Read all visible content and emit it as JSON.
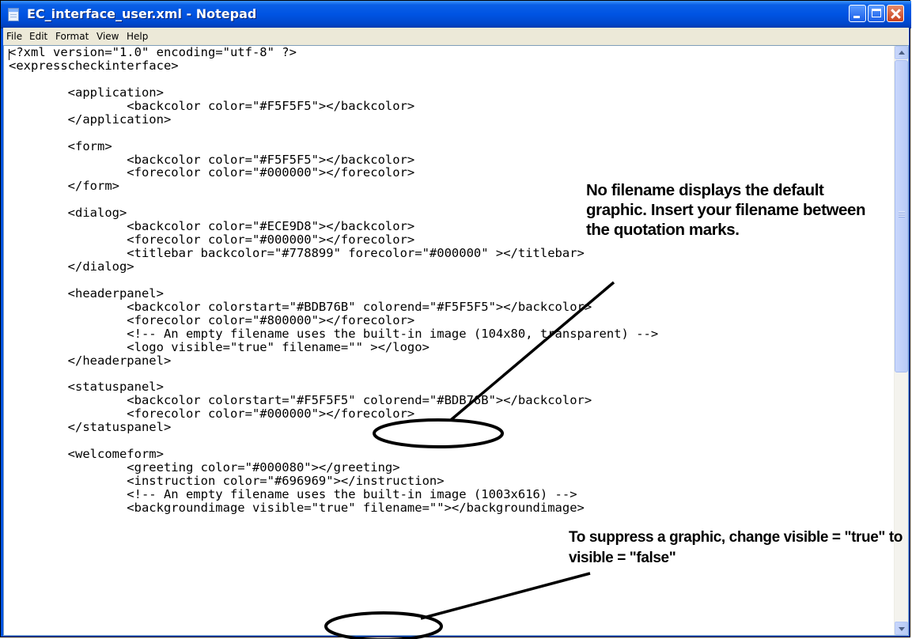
{
  "window": {
    "title": "EC_interface_user.xml - Notepad"
  },
  "menu": [
    "File",
    "Edit",
    "Format",
    "View",
    "Help"
  ],
  "editor": {
    "lines": [
      "<?xml version=\"1.0\" encoding=\"utf-8\" ?>",
      "<expresscheckinterface>",
      "",
      "        <application>",
      "                <backcolor color=\"#F5F5F5\"></backcolor>",
      "        </application>",
      "",
      "        <form>",
      "                <backcolor color=\"#F5F5F5\"></backcolor>",
      "                <forecolor color=\"#000000\"></forecolor>",
      "        </form>",
      "",
      "        <dialog>",
      "                <backcolor color=\"#ECE9D8\"></backcolor>",
      "                <forecolor color=\"#000000\"></forecolor>",
      "                <titlebar backcolor=\"#778899\" forecolor=\"#000000\" ></titlebar>",
      "        </dialog>",
      "",
      "        <headerpanel>",
      "                <backcolor colorstart=\"#BDB76B\" colorend=\"#F5F5F5\"></backcolor>",
      "                <forecolor color=\"#800000\"></forecolor>",
      "                <!-- An empty filename uses the built-in image (104x80, transparent) -->",
      "                <logo visible=\"true\" filename=\"\" ></logo>",
      "        </headerpanel>",
      "",
      "        <statuspanel>",
      "                <backcolor colorstart=\"#F5F5F5\" colorend=\"#BDB76B\"></backcolor>",
      "                <forecolor color=\"#000000\"></forecolor>",
      "        </statuspanel>",
      "",
      "        <welcomeform>",
      "                <greeting color=\"#000080\"></greeting>",
      "                <instruction color=\"#696969\"></instruction>",
      "                <!-- An empty filename uses the built-in image (1003x616) -->",
      "                <backgroundimage visible=\"true\" filename=\"\"></backgroundimage>"
    ]
  },
  "annotations": {
    "top": "No filename displays the default graphic. Insert your filename between the quotation marks.",
    "bottom": "To suppress a graphic, change visible = \"true\" to visible = \"false\""
  }
}
